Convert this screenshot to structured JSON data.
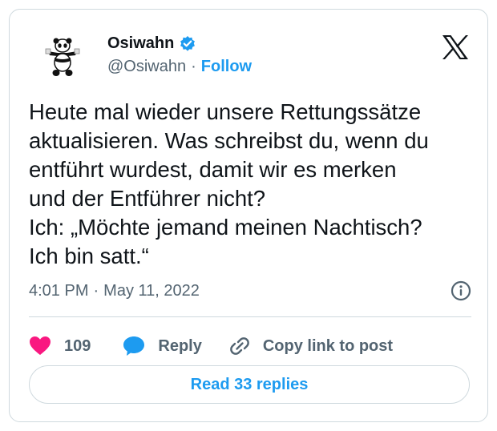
{
  "author": {
    "name": "Osiwahn",
    "handle": "@Osiwahn",
    "separator": "·",
    "follow_label": "Follow"
  },
  "tweet": {
    "text": "Heute mal wieder unsere Rettungssätze\naktualisieren. Was schreibst du, wenn du\nentführt wurdest, damit wir es merken\nund der Entführer nicht?\nIch: „Möchte jemand meinen Nachtisch?\nIch bin satt.“"
  },
  "meta": {
    "time": "4:01 PM",
    "separator": "·",
    "date": "May 11, 2022"
  },
  "actions": {
    "like_count": "109",
    "reply_label": "Reply",
    "copy_label": "Copy link to post"
  },
  "read_replies_label": "Read 33 replies",
  "colors": {
    "accent": "#1d9bf0",
    "like": "#f91880",
    "text": "#0f1419",
    "secondary": "#536471",
    "border": "#cfd9de"
  },
  "icons": [
    "panda-avatar",
    "verified-badge-icon",
    "x-logo-icon",
    "info-icon",
    "heart-icon",
    "speech-bubble-icon",
    "link-icon"
  ]
}
